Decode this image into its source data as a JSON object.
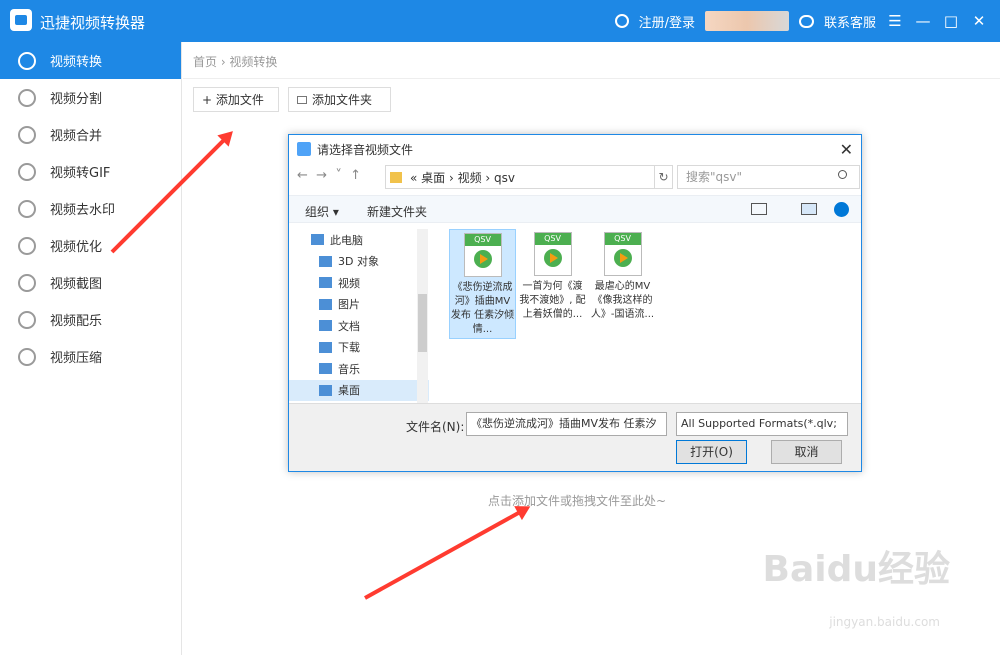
{
  "app": {
    "title": "迅捷视频转换器",
    "register_login": "注册/登录",
    "service": "联系客服"
  },
  "sidebar": {
    "items": [
      {
        "label": "视频转换"
      },
      {
        "label": "视频分割"
      },
      {
        "label": "视频合并"
      },
      {
        "label": "视频转GIF"
      },
      {
        "label": "视频去水印"
      },
      {
        "label": "视频优化"
      },
      {
        "label": "视频截图"
      },
      {
        "label": "视频配乐"
      },
      {
        "label": "视频压缩"
      }
    ]
  },
  "main": {
    "breadcrumb": "首页 › 视频转换",
    "add_file": "+ 添加文件",
    "add_folder": "添加文件夹",
    "drop_hint": "点击添加文件或拖拽文件至此处~"
  },
  "dialog": {
    "title": "请选择音视频文件",
    "address": "« 桌面 › 视频 › qsv",
    "search_placeholder": "搜索\"qsv\"",
    "organize": "组织 ▾",
    "new_folder": "新建文件夹",
    "tree": [
      {
        "label": "此电脑"
      },
      {
        "label": "3D 对象"
      },
      {
        "label": "视频"
      },
      {
        "label": "图片"
      },
      {
        "label": "文档"
      },
      {
        "label": "下载"
      },
      {
        "label": "音乐"
      },
      {
        "label": "桌面"
      }
    ],
    "files": [
      {
        "name": "《悲伤逆流成河》插曲MV发布 任素汐倾情..."
      },
      {
        "name": "一首为何《渡我不渡她》, 配上着妖僧的..."
      },
      {
        "name": "最虐心的MV《像我这样的人》-国语流..."
      }
    ],
    "filename_label": "文件名(N):",
    "filename_value": "《悲伤逆流成河》插曲MV发布 任素汐",
    "filter": "All Supported Formats(*.qlv;",
    "open": "打开(O)",
    "cancel": "取消"
  },
  "watermark": {
    "brand": "Baidu经验",
    "url": "jingyan.baidu.com"
  }
}
